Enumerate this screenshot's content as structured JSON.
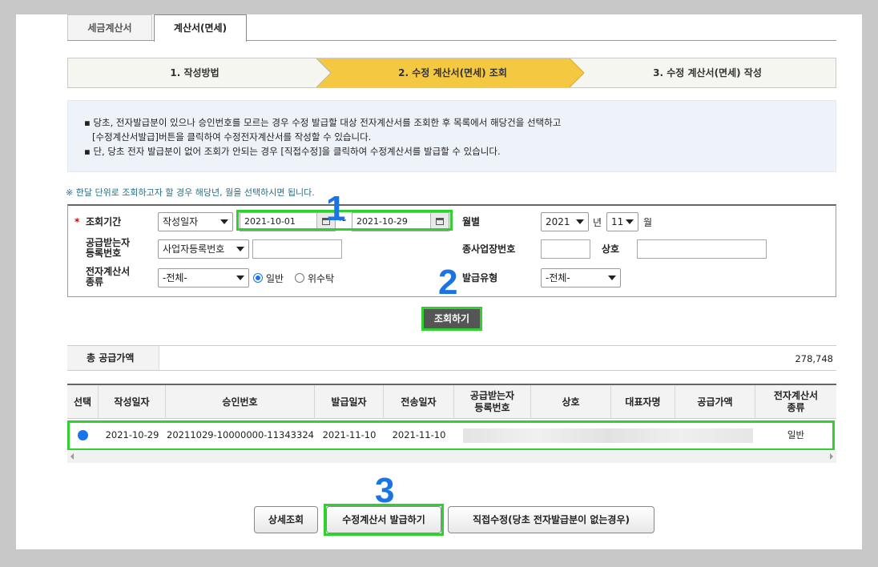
{
  "tabs": [
    "세금계산서",
    "계산서(면세)"
  ],
  "steps": [
    "1. 작성방법",
    "2. 수정 계산서(면세) 조회",
    "3. 수정 계산서(면세) 작성"
  ],
  "info": {
    "line1": "▪ 당초, 전자발급분이 있으나 승인번호를 모르는 경우 수정 발급할 대상 전자계산서를 조회한 후 목록에서 해당건을 선택하고",
    "line2": "[수정계산서발급]버튼을 클릭하여 수정전자계산서를 작성할 수 있습니다.",
    "line3": "▪ 단, 당초 전자 발급분이 없어 조회가 안되는 경우 [직접수정]을 클릭하여 수정계산서를 발급할 수 있습니다."
  },
  "note": "※ 한달 단위로 조회하고자 할 경우 해당년, 월을 선택하시면 됩니다.",
  "search": {
    "period_label": "조회기간",
    "required_mark": "*",
    "date_type": "작성일자",
    "date_from": "2021-10-01",
    "date_sep": "~",
    "date_to": "2021-10-29",
    "month_label": "월별",
    "year": "2021",
    "year_unit": "년",
    "month": "11",
    "month_unit": "월",
    "recipient_label_1": "공급받는자",
    "recipient_label_2": "등록번호",
    "recipient_type": "사업자등록번호",
    "recipient_value": "",
    "sub_biz_label": "종사업장번호",
    "sub_biz_value": "",
    "company_label": "상호",
    "company_value": "",
    "einvoice_label_1": "전자계산서",
    "einvoice_label_2": "종류",
    "einvoice_type": "-전체-",
    "radio_normal": "일반",
    "radio_consign": "위수탁",
    "issue_type_label": "발급유형",
    "issue_type": "-전체-",
    "search_button": "조회하기"
  },
  "markers": [
    "1",
    "2",
    "3"
  ],
  "total": {
    "label": "총 공급가액",
    "value": "278,748"
  },
  "table": {
    "headers": [
      "선택",
      "작성일자",
      "승인번호",
      "발급일자",
      "전송일자",
      "공급받는자\n등록번호",
      "상호",
      "대표자명",
      "공급가액",
      "전자계산서\n종류"
    ],
    "rows": [
      {
        "date": "2021-10-29",
        "approval": "20211029-10000000-11343324",
        "issue_date": "2021-11-10",
        "send_date": "2021-11-10",
        "kind": "일반"
      }
    ]
  },
  "buttons": {
    "detail": "상세조회",
    "issue": "수정계산서 발급하기",
    "direct": "직접수정(당초 전자발급분이 없는경우)"
  },
  "colors": {
    "highlight": "#2ed12e",
    "marker": "#1b74e4",
    "active_step": "#f5c842"
  }
}
